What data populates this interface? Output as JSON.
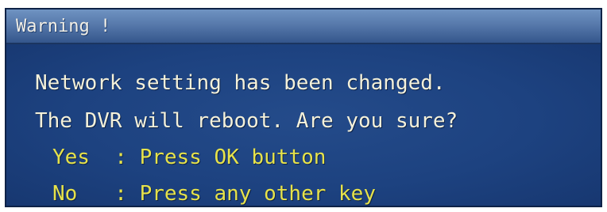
{
  "dialog": {
    "title": "Warning !",
    "message_line_1": "Network setting has been changed.",
    "message_line_2": "The DVR will reboot. Are you sure?",
    "option_yes": "Yes  : Press OK button",
    "option_no": "No   : Press any other key",
    "colors": {
      "background": "#1a3d78",
      "titlebar": "#5779ab",
      "message_text": "#f4f1da",
      "option_text": "#e6e24a"
    }
  }
}
